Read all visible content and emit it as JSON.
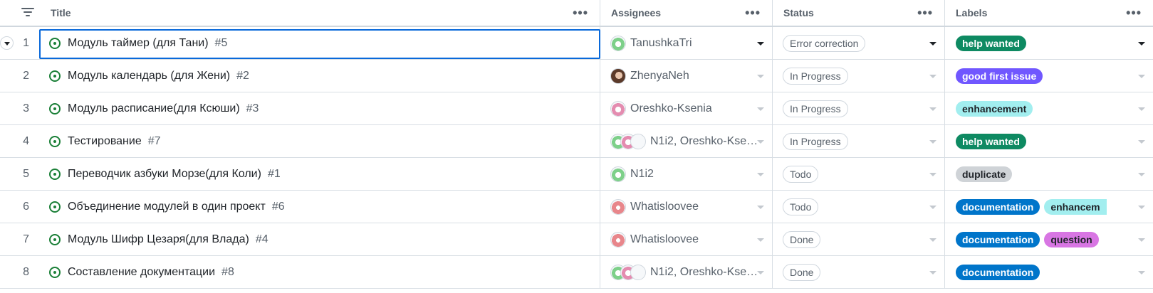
{
  "header": {
    "title_label": "Title",
    "assignees_label": "Assignees",
    "status_label": "Status",
    "labels_label": "Labels",
    "menu_glyph": "•••"
  },
  "colors": {
    "selection_border": "#0969da",
    "open_issue": "#1a7f37",
    "label_help_wanted": "#0e8a62",
    "label_good_first_issue": "#7057ff",
    "label_enhancement": "#a2eeef",
    "label_duplicate": "#cfd3d7",
    "label_documentation": "#0075ca",
    "label_question": "#d876e3"
  },
  "rows": [
    {
      "num": "1",
      "title": "Модуль таймер (для Тани)",
      "issue": "#5",
      "assignees": "TanushkaTri",
      "status": "Error correction",
      "labels": [
        "help wanted"
      ]
    },
    {
      "num": "2",
      "title": "Модуль календарь (для Жени)",
      "issue": "#2",
      "assignees": "ZhenyaNeh",
      "status": "In Progress",
      "labels": [
        "good first issue"
      ]
    },
    {
      "num": "3",
      "title": "Модуль расписание(для Ксюши)",
      "issue": "#3",
      "assignees": "Oreshko-Ksenia",
      "status": "In Progress",
      "labels": [
        "enhancement"
      ]
    },
    {
      "num": "4",
      "title": "Тестирование",
      "issue": "#7",
      "assignees": "N1i2, Oreshko-Kse…",
      "status": "In Progress",
      "labels": [
        "help wanted"
      ]
    },
    {
      "num": "5",
      "title": "Переводчик азбуки Морзе(для Коли)",
      "issue": "#1",
      "assignees": "N1i2",
      "status": "Todo",
      "labels": [
        "duplicate"
      ]
    },
    {
      "num": "6",
      "title": "Объединение модулей в один проект",
      "issue": "#6",
      "assignees": "Whatisloovee",
      "status": "Todo",
      "labels": [
        "documentation",
        "enhancem"
      ]
    },
    {
      "num": "7",
      "title": "Модуль Шифр Цезаря(для Влада)",
      "issue": "#4",
      "assignees": "Whatisloovee",
      "status": "Done",
      "labels": [
        "documentation",
        "question"
      ]
    },
    {
      "num": "8",
      "title": "Составление документации",
      "issue": "#8",
      "assignees": "N1i2, Oreshko-Kse…",
      "status": "Done",
      "labels": [
        "documentation"
      ]
    }
  ]
}
